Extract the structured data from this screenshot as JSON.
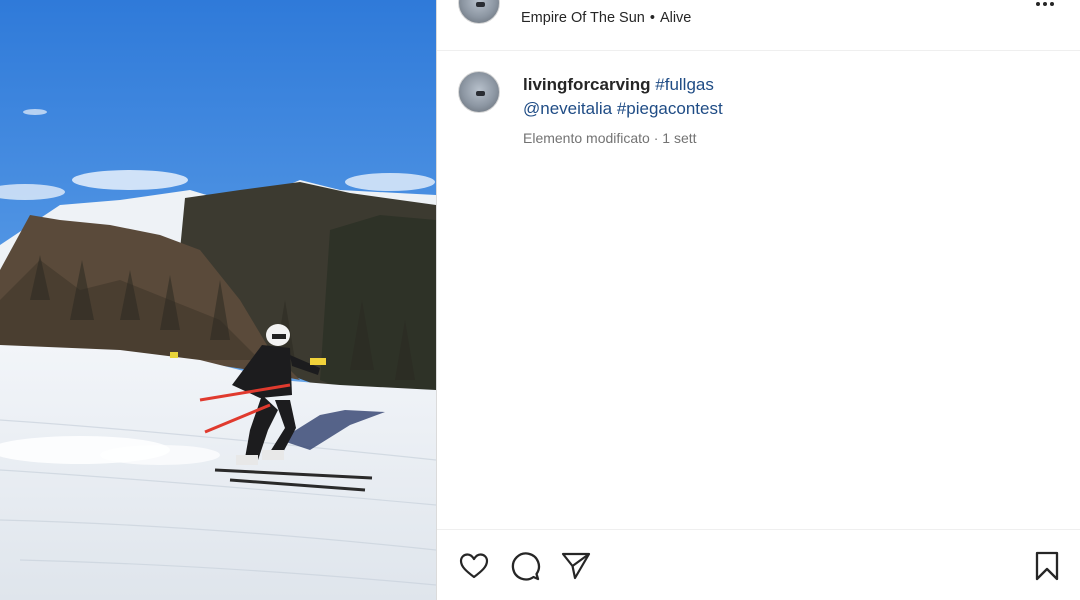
{
  "post": {
    "audio": {
      "artist": "Empire Of The Sun",
      "separator": "•",
      "track": "Alive"
    },
    "caption": {
      "username": "livingforcarving",
      "hashtag1": "#fullgas",
      "mention": "@neveitalia",
      "hashtag2": "#piegacontest"
    },
    "meta": {
      "edited_label": "Elemento modificato",
      "separator": "·",
      "time_ago": "1 sett"
    }
  },
  "icons": {
    "more": "more-horizontal-icon",
    "like": "heart-icon",
    "comment": "comment-icon",
    "share": "paper-plane-icon",
    "save": "bookmark-icon"
  },
  "colors": {
    "link": "#1f4c85",
    "text": "#262626",
    "secondary": "#737373"
  }
}
